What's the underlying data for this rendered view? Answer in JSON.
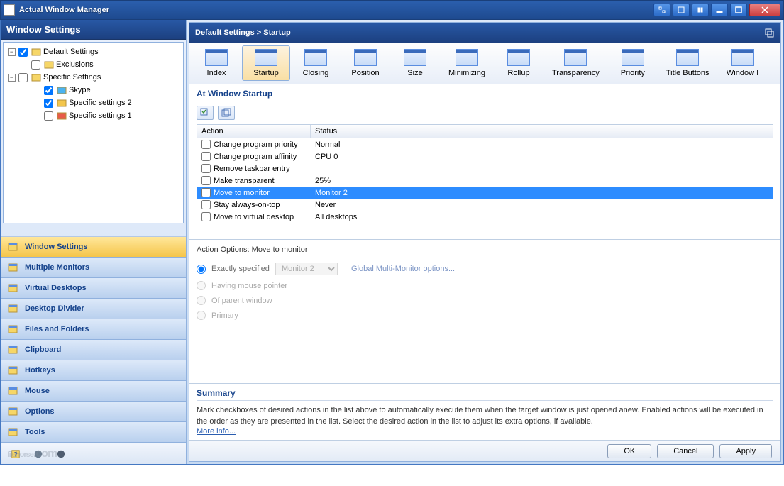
{
  "window": {
    "title": "Actual Window Manager"
  },
  "sidebar": {
    "header": "Window Settings",
    "tree": [
      {
        "label": "Default Settings",
        "checked": true,
        "level": 0,
        "expander": "-"
      },
      {
        "label": "Exclusions",
        "checked": false,
        "level": 1
      },
      {
        "label": "Specific Settings",
        "checked": false,
        "level": 0,
        "expander": "-"
      },
      {
        "label": "Skype",
        "checked": true,
        "level": 2,
        "iconColor": "#4bb3f0"
      },
      {
        "label": "Specific settings 2",
        "checked": true,
        "level": 2,
        "iconColor": "#f3c64c"
      },
      {
        "label": "Specific settings 1",
        "checked": false,
        "level": 2,
        "iconColor": "#e85b4a"
      }
    ],
    "nav": [
      "Window Settings",
      "Multiple Monitors",
      "Virtual Desktops",
      "Desktop Divider",
      "Files and Folders",
      "Clipboard",
      "Hotkeys",
      "Mouse",
      "Options",
      "Tools"
    ],
    "navActive": 0
  },
  "main": {
    "breadcrumb": "Default Settings > Startup",
    "toolbar": [
      "Index",
      "Startup",
      "Closing",
      "Position",
      "Size",
      "Minimizing",
      "Rollup",
      "Transparency",
      "Priority",
      "Title Buttons",
      "Window I"
    ],
    "toolbarActive": 1,
    "sectionTitle": "At Window Startup",
    "columns": {
      "action": "Action",
      "status": "Status"
    },
    "rows": [
      {
        "action": "Change program priority",
        "status": "Normal",
        "checked": false
      },
      {
        "action": "Change program affinity",
        "status": "CPU 0",
        "checked": false
      },
      {
        "action": "Remove taskbar entry",
        "status": "",
        "checked": false
      },
      {
        "action": "Make transparent",
        "status": "25%",
        "checked": false
      },
      {
        "action": "Move to monitor",
        "status": "Monitor 2",
        "checked": false,
        "selected": true
      },
      {
        "action": "Stay always-on-top",
        "status": "Never",
        "checked": false
      },
      {
        "action": "Move to virtual desktop",
        "status": "All desktops",
        "checked": false
      }
    ],
    "options": {
      "title": "Action Options: Move to monitor",
      "choices": [
        "Exactly specified",
        "Having mouse pointer",
        "Of parent window",
        "Primary"
      ],
      "selected": 0,
      "monitor": "Monitor 2",
      "link": "Global Multi-Monitor options..."
    },
    "summary": {
      "title": "Summary",
      "text": "Mark checkboxes of desired actions in the list above to automatically execute them when the target window is just opened anew. Enabled actions will be executed in the order as they are presented in the list. Select the desired action in the list to adjust its extra options, if available.",
      "link": "More info..."
    }
  },
  "buttons": {
    "ok": "OK",
    "cancel": "Cancel",
    "apply": "Apply"
  },
  "watermark": "filehorse",
  "watermark_tld": ".com"
}
